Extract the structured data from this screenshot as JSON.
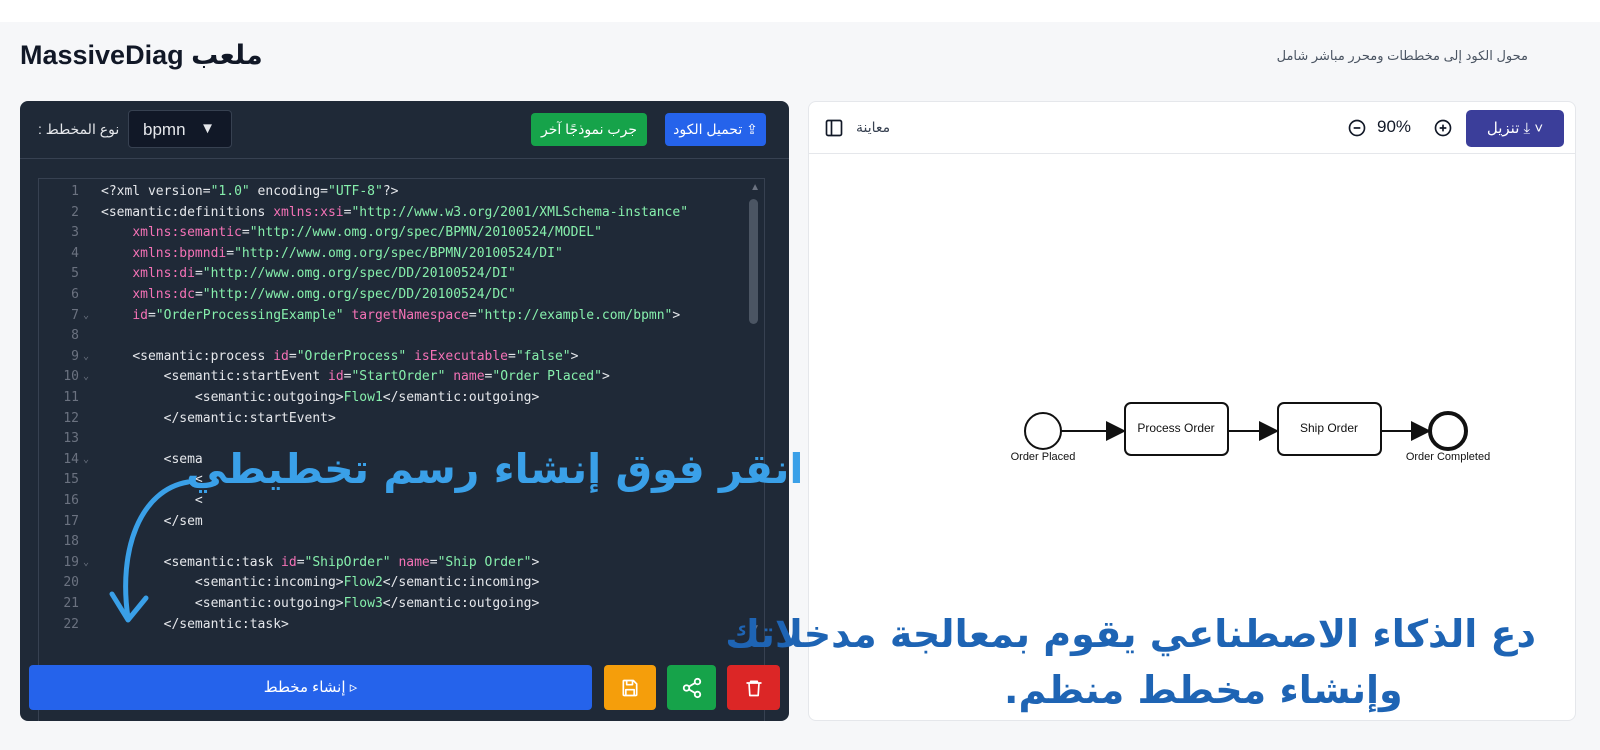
{
  "header": {
    "title": "MassiveDiag ملعب",
    "subtitle": "محول الكود إلى مخططات ومحرر مباشر شامل"
  },
  "editor": {
    "type_label": ": نوع المخطط",
    "type_value": "bpmn",
    "try_sample_label": "جرب نموذجًا آخر",
    "load_code_label": "تحميل الكود ⇪",
    "lines": [
      {
        "n": "1",
        "fold": false,
        "html": "<span class='t'>&lt;?xml </span><span class='t'>version=</span><span class='s'>\"1.0\"</span><span class='t'> encoding=</span><span class='s'>\"UTF-8\"</span><span class='t'>?&gt;</span>"
      },
      {
        "n": "2",
        "fold": false,
        "html": "<span class='t'>&lt;semantic:definitions </span><span class='a'>xmlns:xsi</span><span class='t'>=</span><span class='s'>\"http://www.w3.org/2001/XMLSchema-instance\"</span>"
      },
      {
        "n": "3",
        "fold": false,
        "html": "    <span class='a'>xmlns:semantic</span><span class='t'>=</span><span class='s'>\"http://www.omg.org/spec/BPMN/20100524/MODEL\"</span>"
      },
      {
        "n": "4",
        "fold": false,
        "html": "    <span class='a'>xmlns:bpmndi</span><span class='t'>=</span><span class='s'>\"http://www.omg.org/spec/BPMN/20100524/DI\"</span>"
      },
      {
        "n": "5",
        "fold": false,
        "html": "    <span class='a'>xmlns:di</span><span class='t'>=</span><span class='s'>\"http://www.omg.org/spec/DD/20100524/DI\"</span>"
      },
      {
        "n": "6",
        "fold": false,
        "html": "    <span class='a'>xmlns:dc</span><span class='t'>=</span><span class='s'>\"http://www.omg.org/spec/DD/20100524/DC\"</span>"
      },
      {
        "n": "7",
        "fold": true,
        "html": "    <span class='a'>id</span><span class='t'>=</span><span class='s'>\"OrderProcessingExample\"</span><span class='t'> </span><span class='a'>targetNamespace</span><span class='t'>=</span><span class='s'>\"http://example.com/bpmn\"</span><span class='t'>&gt;</span>"
      },
      {
        "n": "8",
        "fold": false,
        "html": ""
      },
      {
        "n": "9",
        "fold": true,
        "html": "    <span class='t'>&lt;semantic:process </span><span class='a'>id</span><span class='t'>=</span><span class='s'>\"OrderProcess\"</span><span class='t'> </span><span class='a'>isExecutable</span><span class='t'>=</span><span class='s'>\"false\"</span><span class='t'>&gt;</span>"
      },
      {
        "n": "10",
        "fold": true,
        "html": "        <span class='t'>&lt;semantic:startEvent </span><span class='a'>id</span><span class='t'>=</span><span class='s'>\"StartOrder\"</span><span class='t'> </span><span class='a'>name</span><span class='t'>=</span><span class='s'>\"Order Placed\"</span><span class='t'>&gt;</span>"
      },
      {
        "n": "11",
        "fold": false,
        "html": "            <span class='t'>&lt;semantic:outgoing&gt;</span><span class='s'>Flow1</span><span class='t'>&lt;/semantic:outgoing&gt;</span>"
      },
      {
        "n": "12",
        "fold": false,
        "html": "        <span class='t'>&lt;/semantic:startEvent&gt;</span>"
      },
      {
        "n": "13",
        "fold": false,
        "html": ""
      },
      {
        "n": "14",
        "fold": true,
        "html": "        <span class='t'>&lt;sema</span>"
      },
      {
        "n": "15",
        "fold": false,
        "html": "            <span class='t'>&lt;</span>"
      },
      {
        "n": "16",
        "fold": false,
        "html": "            <span class='t'>&lt;</span>"
      },
      {
        "n": "17",
        "fold": false,
        "html": "        <span class='t'>&lt;/sem</span>"
      },
      {
        "n": "18",
        "fold": false,
        "html": ""
      },
      {
        "n": "19",
        "fold": true,
        "html": "        <span class='t'>&lt;semantic:task </span><span class='a'>id</span><span class='t'>=</span><span class='s'>\"ShipOrder\"</span><span class='t'> </span><span class='a'>name</span><span class='t'>=</span><span class='s'>\"Ship Order\"</span><span class='t'>&gt;</span>"
      },
      {
        "n": "20",
        "fold": false,
        "html": "            <span class='t'>&lt;semantic:incoming&gt;</span><span class='s'>Flow2</span><span class='t'>&lt;/semantic:incoming&gt;</span>"
      },
      {
        "n": "21",
        "fold": false,
        "html": "            <span class='t'>&lt;semantic:outgoing&gt;</span><span class='s'>Flow3</span><span class='t'>&lt;/semantic:outgoing&gt;</span>"
      },
      {
        "n": "22",
        "fold": false,
        "html": "        <span class='t'>&lt;/semantic:task&gt;</span>"
      }
    ],
    "generate_label": "إنشاء مخطط ▹",
    "overlay_text": "انقر فوق إنشاء رسم تخطيطي"
  },
  "preview": {
    "label": "معاينة",
    "zoom": "90%",
    "download_label": "تنزيل ⤓ ˅",
    "overlay_line1": "دع الذكاء الاصطناعي يقوم بمعالجة مدخلاتك",
    "overlay_line2": ".وإنشاء مخطط منظم",
    "diagram": {
      "start_label": "Order Placed",
      "task1_label": "Process Order",
      "task2_label": "Ship Order",
      "end_label": "Order Completed"
    }
  },
  "colors": {
    "accent_blue": "#2563eb",
    "accent_green": "#16a34a",
    "accent_amber": "#f59e0b",
    "accent_red": "#dc2626",
    "download_indigo": "#3b3e9a",
    "overlay_light_blue": "#3aa0e8",
    "overlay_dark_blue": "#1e64b4"
  }
}
